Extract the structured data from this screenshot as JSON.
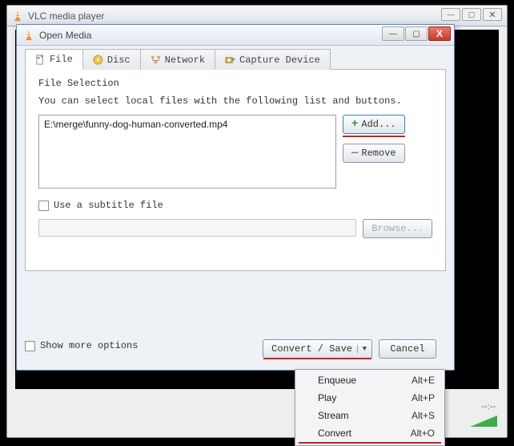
{
  "main_window": {
    "title": "VLC media player",
    "time": "--:--"
  },
  "dialog": {
    "title": "Open Media",
    "tabs": {
      "file": "File",
      "disc": "Disc",
      "network": "Network",
      "capture": "Capture Device"
    },
    "section_label": "File Selection",
    "help_text": "You can select local files with the following list and buttons.",
    "file_entry": "E:\\merge\\funny-dog-human-converted.mp4",
    "add_label": "Add...",
    "remove_label": "Remove",
    "subtitle_label": "Use a subtitle file",
    "browse_label": "Browse...",
    "showmore_label": "Show more options",
    "convert_save_label": "Convert / Save",
    "cancel_label": "Cancel"
  },
  "menu": {
    "items": [
      {
        "label": "Enqueue",
        "shortcut": "Alt+E"
      },
      {
        "label": "Play",
        "shortcut": "Alt+P"
      },
      {
        "label": "Stream",
        "shortcut": "Alt+S"
      },
      {
        "label": "Convert",
        "shortcut": "Alt+O"
      }
    ]
  }
}
